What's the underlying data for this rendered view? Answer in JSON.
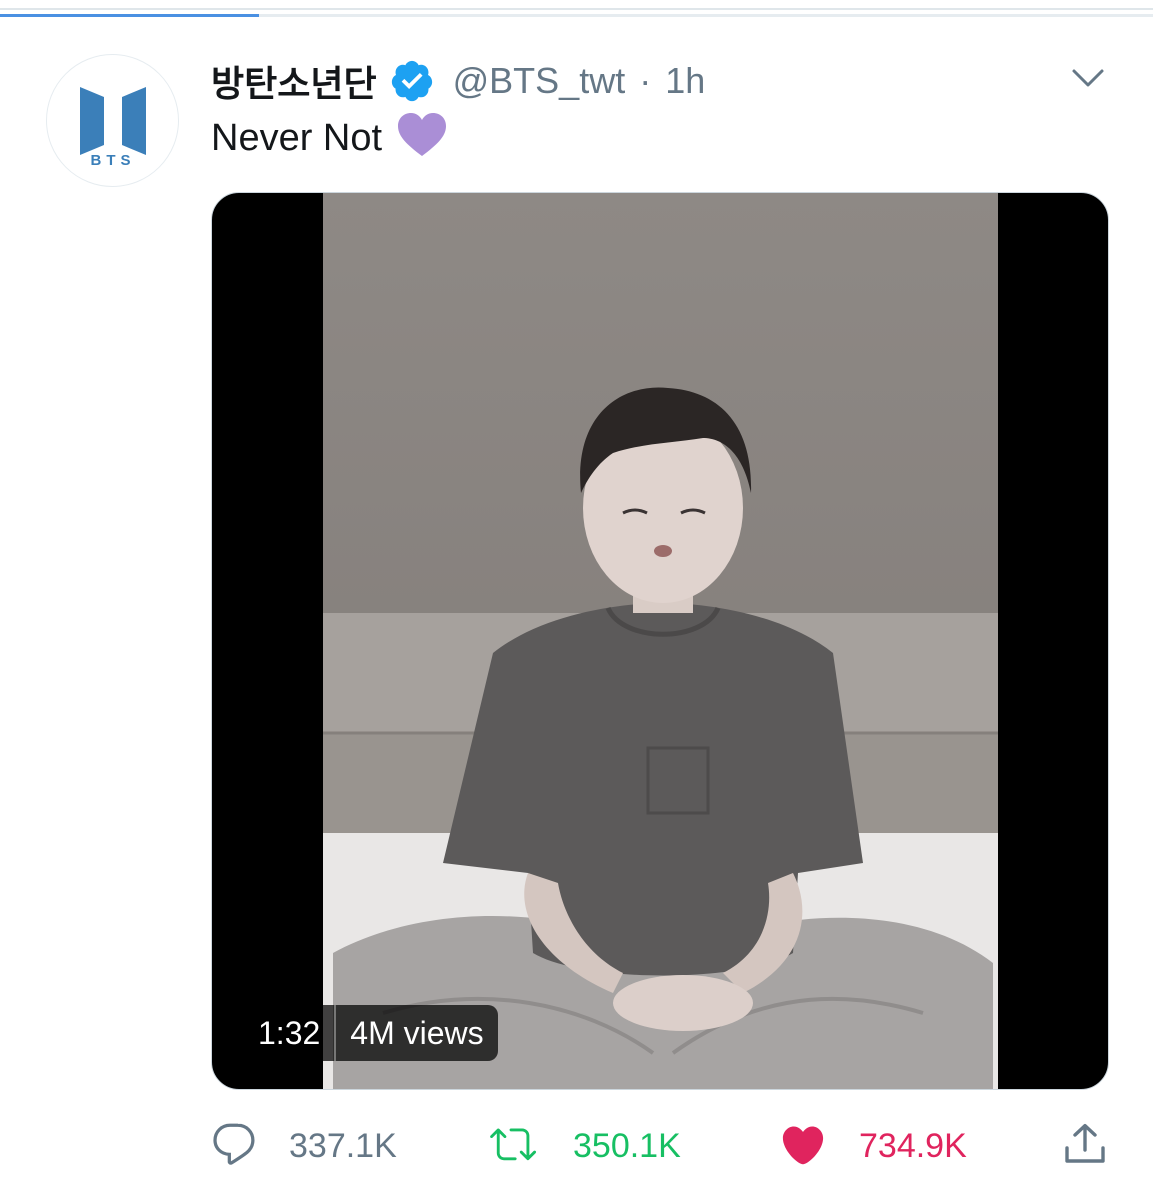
{
  "loading": {
    "progress": 0.225
  },
  "tweet": {
    "display_name": "방탄소년단",
    "verified": true,
    "handle": "@BTS_twt",
    "separator": "·",
    "time": "1h",
    "text": "Never Not",
    "emoji": "purple-heart",
    "avatar_logo_text": "BTS"
  },
  "media": {
    "type": "video",
    "duration": "1:32",
    "views": "4M views"
  },
  "actions": {
    "replies": "337.1K",
    "retweets": "350.1K",
    "likes": "734.9K"
  },
  "colors": {
    "text_primary": "#14171a",
    "text_secondary": "#657786",
    "verified_blue": "#1da1f2",
    "retweet_green": "#17bf63",
    "like_red": "#e0245e",
    "emoji_purple": "#aa8ed6",
    "bts_blue": "#3b7fb9"
  }
}
